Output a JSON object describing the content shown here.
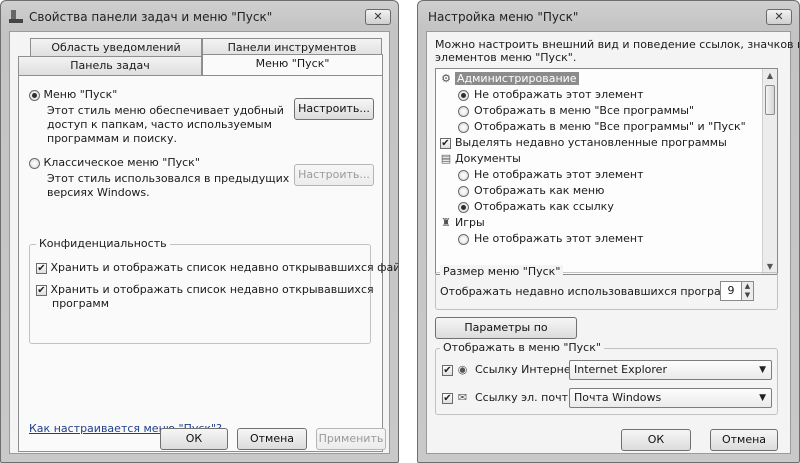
{
  "left_dialog": {
    "title": "Свойства панели задач и меню \"Пуск\"",
    "close_label": "✕",
    "tabs_back": [
      "Область уведомлений",
      "Панели инструментов"
    ],
    "tabs_front": [
      "Панель задач",
      "Меню \"Пуск\""
    ],
    "start_menu_radio": {
      "label": "Меню \"Пуск\"",
      "desc": [
        "Этот стиль меню обеспечивает удобный",
        "доступ к папкам, часто используемым",
        "программам и поиску."
      ],
      "checked": true
    },
    "configure_button": "Настроить...",
    "classic_radio": {
      "label": "Классическое меню \"Пуск\"",
      "desc": [
        "Этот стиль использовался в предыдущих",
        "версиях Windows."
      ],
      "checked": false
    },
    "configure_button_disabled": "Настроить...",
    "privacy": {
      "title": "Конфиденциальность",
      "files_checkbox": "Хранить и отображать список недавно открывавшихся файлов",
      "programs_checkbox": [
        "Хранить и отображать список недавно открывавшихся",
        "программ"
      ]
    },
    "help_link": "Как настраивается меню \"Пуск\"?",
    "buttons": {
      "ok": "ОК",
      "cancel": "Отмена",
      "apply": "Применить"
    }
  },
  "right_dialog": {
    "title": "Настройка меню \"Пуск\"",
    "close_label": "✕",
    "intro": [
      "Можно настроить внешний вид и поведение ссылок, значков и",
      "элементов меню \"Пуск\"."
    ],
    "list": {
      "items": [
        {
          "kind": "header",
          "icon": "admin-icon",
          "text": "Администрирование",
          "selected": true
        },
        {
          "kind": "radio",
          "text": "Не отображать этот элемент",
          "checked": true
        },
        {
          "kind": "radio",
          "text": "Отображать в меню \"Все программы\"",
          "checked": false
        },
        {
          "kind": "radio",
          "text": "Отображать в меню \"Все программы\" и \"Пуск\"",
          "checked": false
        },
        {
          "kind": "check",
          "text": "Выделять недавно установленные программы",
          "checked": true
        },
        {
          "kind": "header",
          "icon": "documents-icon",
          "text": "Документы",
          "selected": false
        },
        {
          "kind": "radio",
          "text": "Не отображать этот элемент",
          "checked": false
        },
        {
          "kind": "radio",
          "text": "Отображать как меню",
          "checked": false
        },
        {
          "kind": "radio",
          "text": "Отображать как ссылку",
          "checked": true
        },
        {
          "kind": "header",
          "icon": "games-icon",
          "text": "Игры",
          "selected": false
        },
        {
          "kind": "radio",
          "text": "Не отображать этот элемент",
          "checked": false
        }
      ]
    },
    "size_group": {
      "title": "Размер меню \"Пуск\"",
      "label": "Отображать недавно использовавшихся программ:",
      "value": "9"
    },
    "defaults_button": "Параметры по умолчанию",
    "show_group": {
      "title": "Отображать в меню \"Пуск\"",
      "internet_label": "Ссылку Интернета:",
      "internet_value": "Internet Explorer",
      "email_label": "Ссылку эл. почты:",
      "email_value": "Почта Windows"
    },
    "buttons": {
      "ok": "ОК",
      "cancel": "Отмена"
    }
  }
}
